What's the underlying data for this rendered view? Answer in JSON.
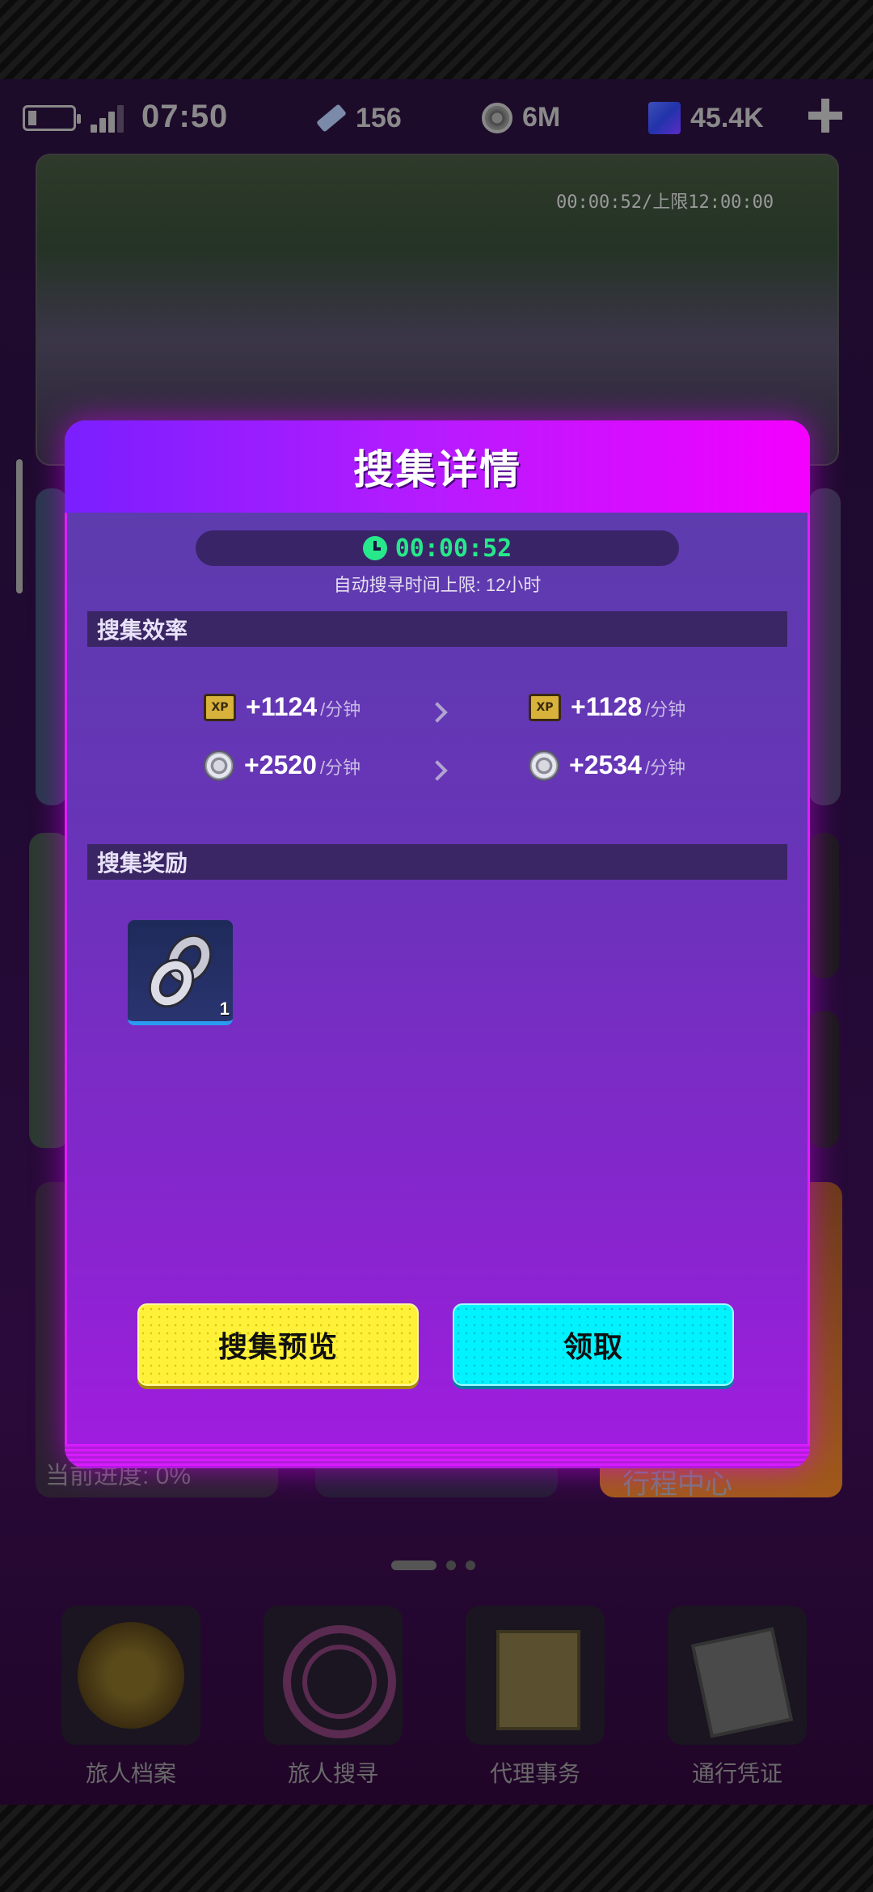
{
  "status_bar": {
    "time": "07:50",
    "tickets": "156",
    "coins": "6M",
    "gems": "45.4K"
  },
  "background": {
    "banner_timer": "00:00:52/上限12:00:00",
    "card_progress_text": "当前进度: 0%",
    "card_right_text": "行程中心",
    "nav": [
      {
        "label": "旅人档案",
        "icon": "archive-icon"
      },
      {
        "label": "旅人搜寻",
        "icon": "radar-icon"
      },
      {
        "label": "代理事务",
        "icon": "task-icon"
      },
      {
        "label": "通行凭证",
        "icon": "pass-icon"
      }
    ]
  },
  "modal": {
    "title": "搜集详情",
    "timer": "00:00:52",
    "limit_text": "自动搜寻时间上限: 12小时",
    "efficiency_section": "搜集效率",
    "rates": [
      {
        "icon": "xp-icon",
        "current": "+1124",
        "next": "+1128",
        "unit": "/分钟"
      },
      {
        "icon": "coin-icon",
        "current": "+2520",
        "next": "+2534",
        "unit": "/分钟"
      }
    ],
    "reward_section": "搜集奖励",
    "reward_item": {
      "icon": "chain-icon",
      "count": "1"
    },
    "preview_button": "搜集预览",
    "claim_button": "领取"
  },
  "colors": {
    "modal_header_start": "#7a1fff",
    "modal_header_end": "#f400ff",
    "timer_green": "#27e88a",
    "button_yellow": "#fff13a",
    "button_cyan": "#00f3ff"
  }
}
